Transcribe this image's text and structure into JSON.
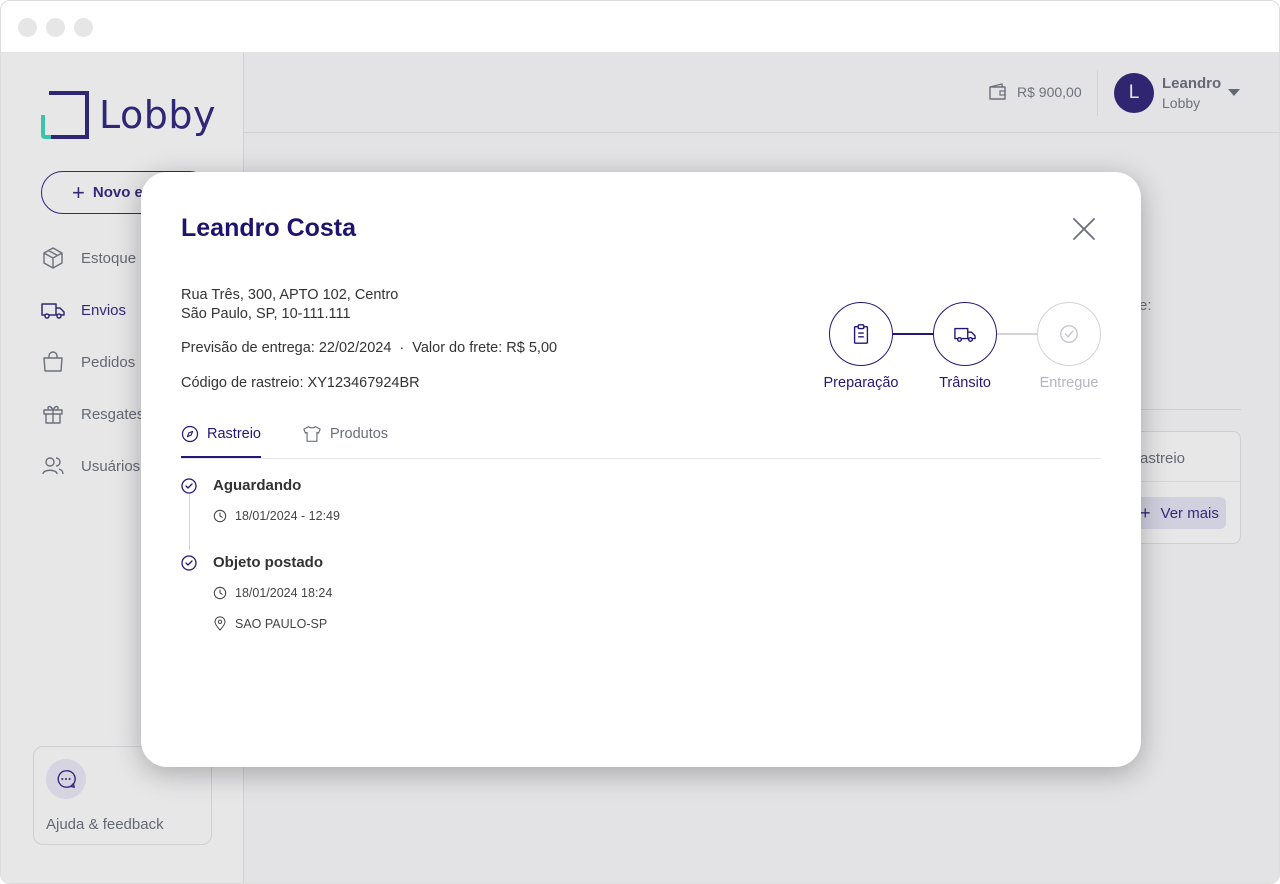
{
  "app": {
    "logo_text": "Lobby",
    "new_button_label": "Novo e",
    "nav": [
      {
        "label": "Estoque",
        "icon": "box-icon"
      },
      {
        "label": "Envios",
        "icon": "truck-icon"
      },
      {
        "label": "Pedidos",
        "icon": "bag-icon"
      },
      {
        "label": "Resgates",
        "icon": "gift-icon"
      },
      {
        "label": "Usuários",
        "icon": "users-icon"
      }
    ],
    "help_label": "Ajuda & feedback"
  },
  "header": {
    "balance": "R$ 900,00",
    "avatar_initial": "L",
    "user_name": "Leandro",
    "user_org": "Lobby"
  },
  "background": {
    "partial_text": "e:",
    "card_title": "astreio",
    "card_button_label": "Ver mais"
  },
  "modal": {
    "title": "Leandro Costa",
    "address_line1": "Rua Três, 300, APTO 102, Centro",
    "address_line2": "São Paulo, SP, 10-111.111",
    "forecast": "Previsão de entrega: 22/02/2024",
    "separator": "·",
    "freight": "Valor do frete: R$ 5,00",
    "tracking_code": "Código de rastreio: XY123467924BR",
    "steps": [
      {
        "label": "Preparação",
        "icon": "clipboard-icon",
        "done": true
      },
      {
        "label": "Trânsito",
        "icon": "truck-icon",
        "done": true
      },
      {
        "label": "Entregue",
        "icon": "check-circle-icon",
        "done": false
      }
    ],
    "tabs": [
      {
        "label": "Rastreio",
        "icon": "compass-icon",
        "active": true
      },
      {
        "label": "Produtos",
        "icon": "shirt-icon",
        "active": false
      }
    ],
    "timeline": [
      {
        "title": "Aguardando",
        "datetime": "18/01/2024 - 12:49"
      },
      {
        "title": "Objeto postado",
        "datetime": "18/01/2024 18:24",
        "location": "SAO PAULO-SP"
      }
    ]
  },
  "colors": {
    "primary": "#231776",
    "avatar_bg": "#1f136d",
    "logo_accent": "#2fd3b5",
    "muted_text": "#6a6e7b",
    "inactive_step": "#d3d3d8"
  }
}
